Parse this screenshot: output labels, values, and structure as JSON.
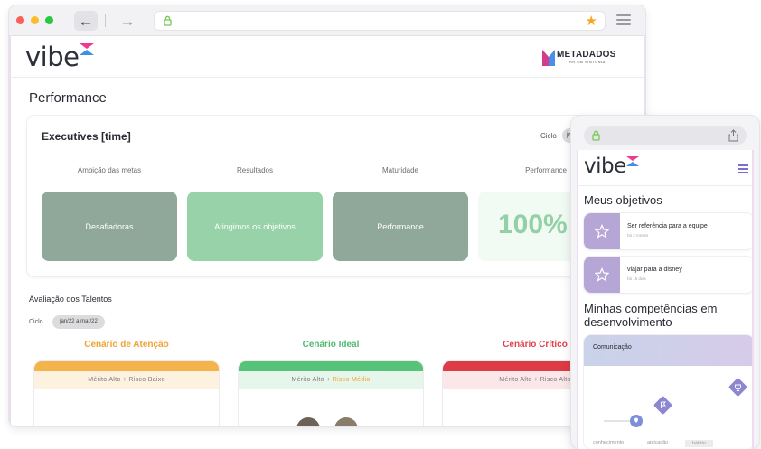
{
  "browser": {
    "nav": {
      "back_glyph": "←",
      "forward_glyph": "→"
    },
    "icons": {
      "lock": "lock-icon",
      "star": "star-icon",
      "menu": "menu-icon"
    },
    "colors": {
      "star": "#f5a623",
      "lock": "#7ac74f"
    }
  },
  "brand": {
    "logo": "vibe",
    "partner_name": "METADADOS",
    "partner_tagline": "RH EM SINTONIA"
  },
  "desktop": {
    "page_title": "Performance",
    "card": {
      "title": "Executives [time]",
      "ciclo_label": "Ciclo",
      "ciclo_value": "ja",
      "columns": [
        {
          "header": "Ambição das metas",
          "value": "Desafiadoras"
        },
        {
          "header": "Resultados",
          "value": "Atingimos os objetivos"
        },
        {
          "header": "Maturidade",
          "value": "Performance"
        },
        {
          "header": "Performance",
          "value": "100%"
        }
      ]
    },
    "talents": {
      "title": "Avaliação dos Talentos",
      "ciclo_label": "Ciclo",
      "ciclo_value": "jan/22 a mar/22",
      "scenarios": [
        {
          "title": "Cenário de Atenção",
          "color": "#f0a233",
          "bar": "#f5b34b",
          "band_bg": "#fdf1e0",
          "band_a": "Mérito Alto",
          "band_b": "Risco Baixo",
          "band_b_color": "#7a7a80"
        },
        {
          "title": "Cenário Ideal",
          "color": "#4fba6f",
          "bar": "#56c27a",
          "band_bg": "#e6f6ea",
          "band_a": "Mérito Alto",
          "band_b": "Risco Médio",
          "band_b_color": "#f0a233"
        },
        {
          "title": "Cenário Crítico",
          "color": "#e0424b",
          "bar": "#dd3b46",
          "band_bg": "#fbe6e8",
          "band_a": "Mérito Alto",
          "band_b": "Risco Alto",
          "band_b_color": "#7a7a80"
        }
      ]
    }
  },
  "mobile": {
    "objectives_title": "Meus objetivos",
    "objectives": [
      {
        "title": "Ser referência para a equipe",
        "subtitle": "há 2 meses"
      },
      {
        "title": "viajar para a disney",
        "subtitle": "há 15 dias"
      }
    ],
    "competencies_title": "Minhas competências em desenvolvimento",
    "competency": {
      "name": "Comunicação",
      "x_labels": [
        "conhecimento",
        "aplicação",
        "hábito"
      ]
    },
    "colors": {
      "accent": "#7a6fd0",
      "icon_bg": "#b5a6d6"
    }
  }
}
